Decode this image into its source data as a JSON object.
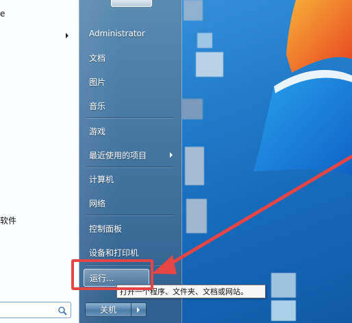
{
  "left_pane": {
    "items": [
      {
        "label": "e"
      },
      {
        "label": "软件"
      }
    ],
    "search": {
      "placeholder": "",
      "icon": "search-icon"
    }
  },
  "right_pane": {
    "items": [
      {
        "id": "administrator",
        "label": "Administrator",
        "has_submenu": false
      },
      {
        "id": "documents",
        "label": "文档",
        "has_submenu": false
      },
      {
        "id": "pictures",
        "label": "图片",
        "has_submenu": false
      },
      {
        "id": "music",
        "label": "音乐",
        "has_submenu": false
      },
      {
        "id": "games",
        "label": "游戏",
        "has_submenu": false
      },
      {
        "id": "recent-items",
        "label": "最近使用的项目",
        "has_submenu": true
      },
      {
        "id": "computer",
        "label": "计算机",
        "has_submenu": false
      },
      {
        "id": "network",
        "label": "网络",
        "has_submenu": false
      },
      {
        "id": "control-panel",
        "label": "控制面板",
        "has_submenu": false
      },
      {
        "id": "devices-printers",
        "label": "设备和打印机",
        "has_submenu": false
      }
    ],
    "run": {
      "label": "运行..."
    },
    "shutdown": {
      "label": "关机",
      "arrow_icon": "chevron-right-icon"
    }
  },
  "tooltip": {
    "text": "打开一个程序、文件夹、文档或网站。"
  },
  "annotation": {
    "color": "#e54545",
    "target": "run"
  },
  "colors": {
    "menu_right_pane": "#4d7ea8",
    "menu_left_pane": "#fbfcfd",
    "desktop": "#1f79c8",
    "highlight": "#e54545"
  }
}
